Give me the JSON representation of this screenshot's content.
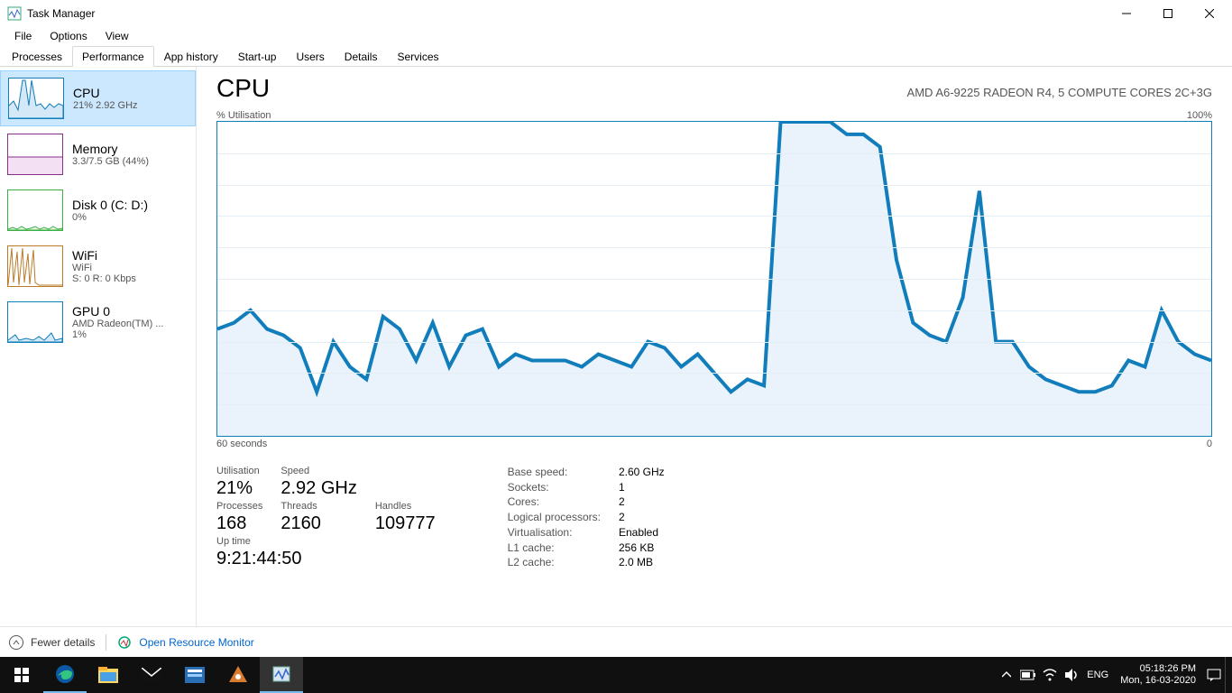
{
  "window": {
    "title": "Task Manager",
    "menus": [
      "File",
      "Options",
      "View"
    ],
    "tabs": [
      "Processes",
      "Performance",
      "App history",
      "Start-up",
      "Users",
      "Details",
      "Services"
    ],
    "active_tab": "Performance",
    "win_controls": {
      "min": "−",
      "max": "▢",
      "close": "✕"
    }
  },
  "sidebar": [
    {
      "name": "CPU",
      "line2": "21%  2.92 GHz",
      "line3": "",
      "color": "#117dbb",
      "thumb": "cpu"
    },
    {
      "name": "Memory",
      "line2": "3.3/7.5 GB (44%)",
      "line3": "",
      "color": "#8b2e8b",
      "thumb": "mem"
    },
    {
      "name": "Disk 0 (C: D:)",
      "line2": "0%",
      "line3": "",
      "color": "#3cb043",
      "thumb": "disk"
    },
    {
      "name": "WiFi",
      "line2": "WiFi",
      "line3": "S: 0 R: 0 Kbps",
      "color": "#b97a2a",
      "thumb": "wifi"
    },
    {
      "name": "GPU 0",
      "line2": "AMD Radeon(TM) ...",
      "line3": "1%",
      "color": "#117dbb",
      "thumb": "gpu"
    }
  ],
  "content": {
    "title": "CPU",
    "subtitle": "AMD A6-9225 RADEON R4, 5 COMPUTE CORES 2C+3G",
    "chart_top_left": "% Utilisation",
    "chart_top_right": "100%",
    "chart_bottom_left": "60 seconds",
    "chart_bottom_right": "0"
  },
  "stats_left": {
    "utilisation_lbl": "Utilisation",
    "utilisation_val": "21%",
    "speed_lbl": "Speed",
    "speed_val": "2.92 GHz",
    "processes_lbl": "Processes",
    "processes_val": "168",
    "threads_lbl": "Threads",
    "threads_val": "2160",
    "handles_lbl": "Handles",
    "handles_val": "109777",
    "uptime_lbl": "Up time",
    "uptime_val": "9:21:44:50"
  },
  "stats_right": {
    "base_speed_lbl": "Base speed:",
    "base_speed_val": "2.60 GHz",
    "sockets_lbl": "Sockets:",
    "sockets_val": "1",
    "cores_lbl": "Cores:",
    "cores_val": "2",
    "logical_lbl": "Logical processors:",
    "logical_val": "2",
    "virt_lbl": "Virtualisation:",
    "virt_val": "Enabled",
    "l1_lbl": "L1 cache:",
    "l1_val": "256 KB",
    "l2_lbl": "L2 cache:",
    "l2_val": "2.0 MB"
  },
  "footer": {
    "fewer": "Fewer details",
    "open_resmon": "Open Resource Monitor"
  },
  "taskbar": {
    "lang": "ENG",
    "time": "05:18:26 PM",
    "date": "Mon, 16-03-2020"
  },
  "chart_data": {
    "type": "area",
    "title": "% Utilisation",
    "xlabel": "60 seconds",
    "ylabel": "% Utilisation",
    "ylim": [
      0,
      100
    ],
    "x_seconds_ago": [
      60,
      59,
      58,
      57,
      56,
      55,
      54,
      53,
      52,
      51,
      50,
      49,
      48,
      47,
      46,
      45,
      44,
      43,
      42,
      41,
      40,
      39,
      38,
      37,
      36,
      35,
      34,
      33,
      32,
      31,
      30,
      29,
      28,
      27,
      26,
      25,
      24,
      23,
      22,
      21,
      20,
      19,
      18,
      17,
      16,
      15,
      14,
      13,
      12,
      11,
      10,
      9,
      8,
      7,
      6,
      5,
      4,
      3,
      2,
      1,
      0
    ],
    "values": [
      34,
      36,
      40,
      34,
      32,
      28,
      14,
      30,
      22,
      18,
      38,
      34,
      24,
      36,
      22,
      32,
      34,
      22,
      26,
      24,
      24,
      24,
      22,
      26,
      24,
      22,
      30,
      28,
      22,
      26,
      20,
      14,
      18,
      16,
      100,
      100,
      100,
      100,
      96,
      96,
      92,
      56,
      36,
      32,
      30,
      44,
      78,
      30,
      30,
      22,
      18,
      16,
      14,
      14,
      16,
      24,
      22,
      40,
      30,
      26,
      24
    ]
  }
}
